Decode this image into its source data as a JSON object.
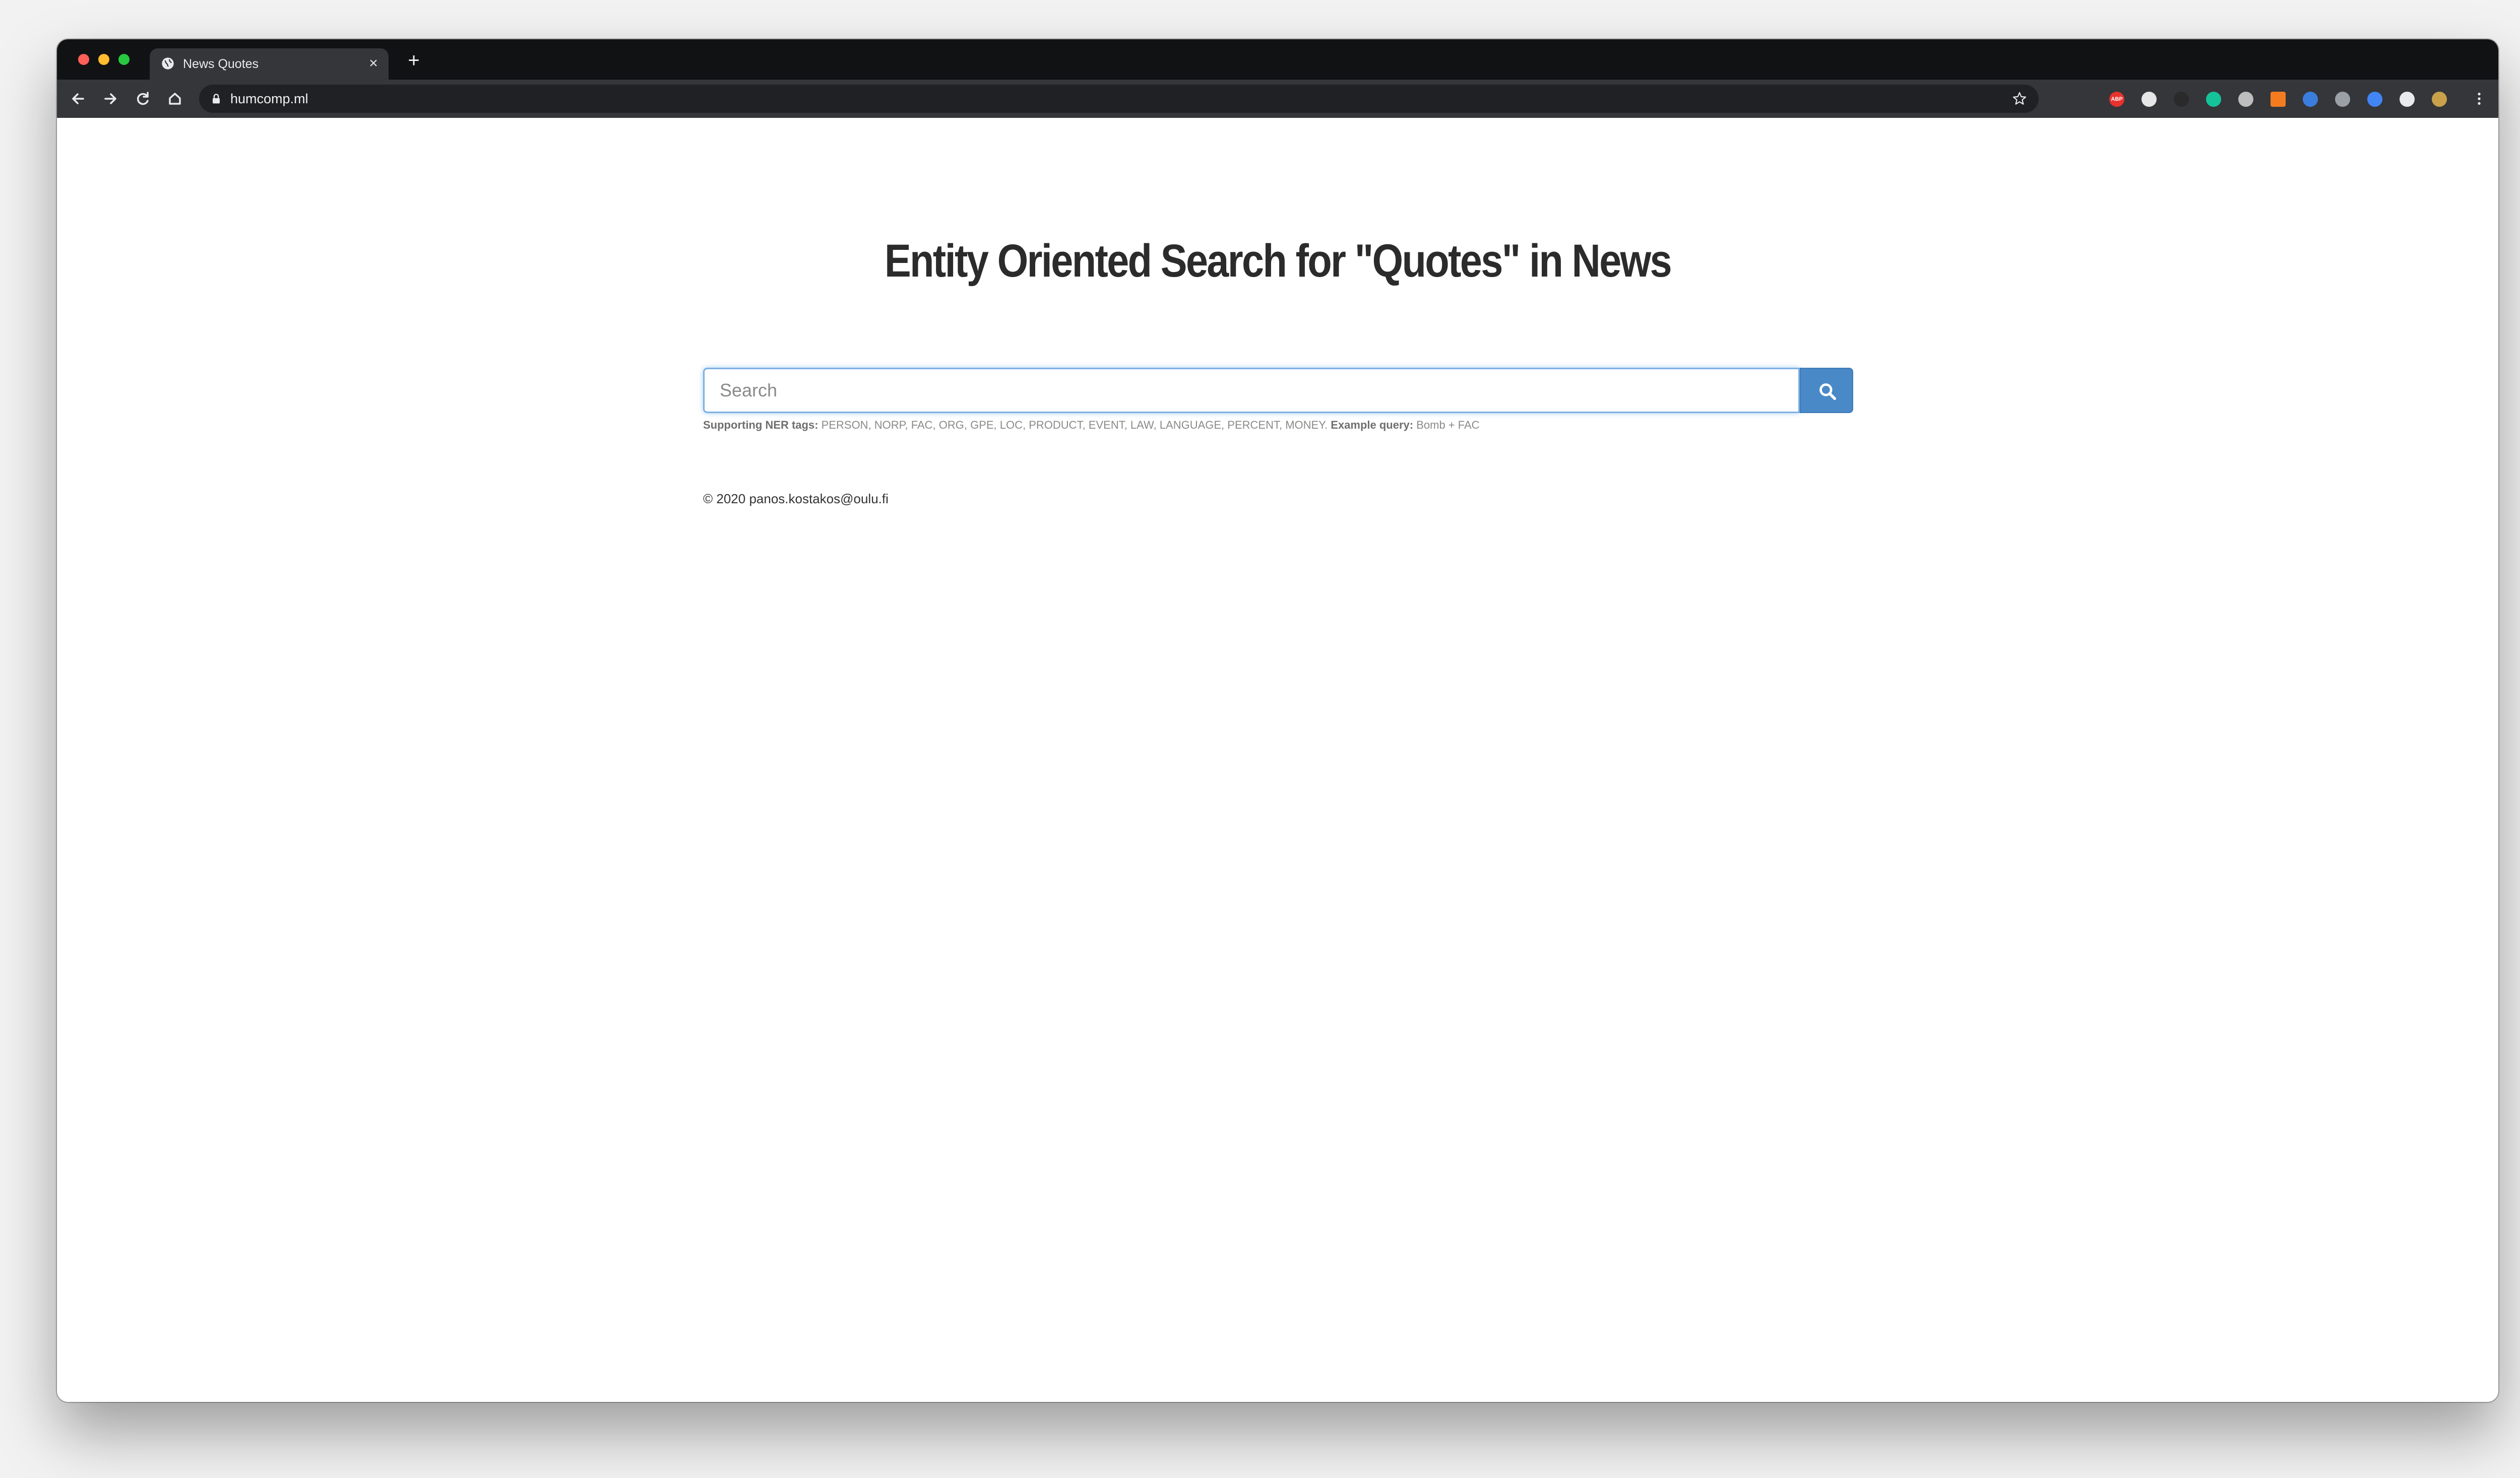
{
  "browser": {
    "tab_title": "News Quotes",
    "new_tab_symbol": "+",
    "close_symbol": "×",
    "url": "humcomp.ml",
    "extensions": [
      {
        "name": "adblock-plus-icon",
        "color": "#e8322e",
        "label": "ABP"
      },
      {
        "name": "extension-white-circle-icon",
        "color": "#e6e6e6"
      },
      {
        "name": "extension-dark-icon",
        "color": "#2a2a2a"
      },
      {
        "name": "grammarly-icon",
        "color": "#15c39a"
      },
      {
        "name": "extension-grey-circle-icon",
        "color": "#bdbdbd"
      },
      {
        "name": "extension-orange-icon",
        "color": "#f47c20"
      },
      {
        "name": "extension-blue-hat-icon",
        "color": "#3b7ddd"
      },
      {
        "name": "extension-people-icon",
        "color": "#9aa0a6"
      },
      {
        "name": "google-translate-icon",
        "color": "#4285f4"
      },
      {
        "name": "extensions-puzzle-icon",
        "color": "#e8eaed"
      },
      {
        "name": "profile-avatar-icon",
        "color": "#c9a14a"
      }
    ]
  },
  "page": {
    "headline": "Entity Oriented Search for \"Quotes\" in News",
    "search_placeholder": "Search",
    "search_value": "",
    "help": {
      "tags_label": "Supporting NER tags:",
      "tags": " PERSON, NORP, FAC, ORG, GPE, LOC, PRODUCT, EVENT, LAW, LANGUAGE, PERCENT, MONEY. ",
      "example_label": "Example query:",
      "example": " Bomb + FAC"
    },
    "footer": "© 2020 panos.kostakos@oulu.fi"
  },
  "colors": {
    "accent": "#4a89c8",
    "headline": "#2b2b2b",
    "help_text": "#8a8a8a"
  }
}
